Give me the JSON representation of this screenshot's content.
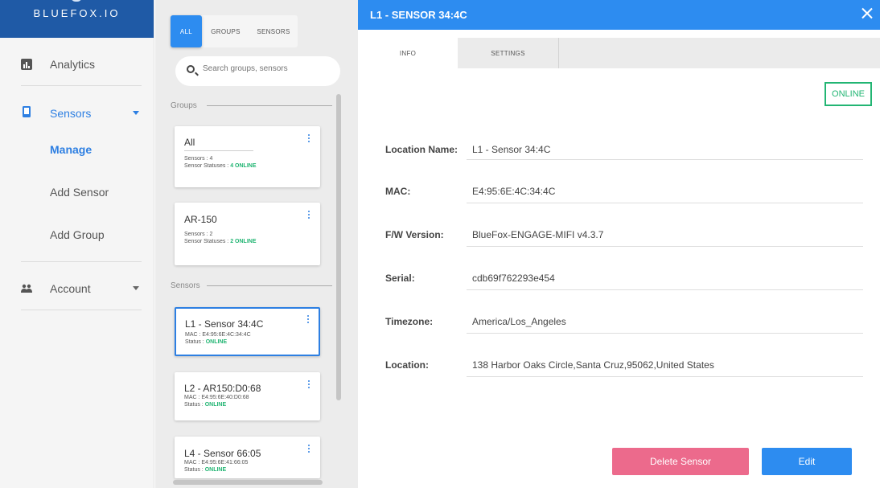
{
  "app": {
    "brand": "BLUEFOX.IO"
  },
  "nav": {
    "analytics": {
      "label": "Analytics",
      "icon": "bar-chart-icon"
    },
    "sensors": {
      "label": "Sensors",
      "icon": "phone-device-icon"
    },
    "sensors_sub": [
      "Manage",
      "Add Sensor",
      "Add Group"
    ],
    "account": {
      "label": "Account",
      "icon": "people-icon"
    }
  },
  "list": {
    "filters": [
      "ALL",
      "GROUPS",
      "SENSORS"
    ],
    "search_placeholder": "Search groups, sensors",
    "groups_heading": "Groups",
    "sensors_heading": "Sensors",
    "groups": [
      {
        "title": "All",
        "sensors": "Sensors : 4",
        "status_prefix": "Sensor Statuses : ",
        "status": "4 ONLINE"
      },
      {
        "title": "AR-150",
        "sensors": "Sensors : 2",
        "status_prefix": "Sensor Statuses : ",
        "status": "2 ONLINE"
      }
    ],
    "sensors": [
      {
        "title": "L1 - Sensor 34:4C",
        "mac": "MAC : E4:95:6E:4C:34:4C",
        "status_prefix": "Status : ",
        "status": "ONLINE"
      },
      {
        "title": "L2 - AR150:D0:68",
        "mac": "MAC : E4:95:6E:40:D0:68",
        "status_prefix": "Status : ",
        "status": "ONLINE"
      },
      {
        "title": "L4 - Sensor 66:05",
        "mac": "MAC : E4:95:6E:41:66:05",
        "status_prefix": "Status : ",
        "status": "ONLINE"
      }
    ]
  },
  "panel": {
    "title": "L1 - SENSOR 34:4C",
    "tabs": [
      "INFO",
      "SETTINGS"
    ],
    "status_badge": "ONLINE",
    "fields": [
      {
        "label": "Location Name:",
        "value": "L1 - Sensor 34:4C"
      },
      {
        "label": "MAC:",
        "value": "E4:95:6E:4C:34:4C"
      },
      {
        "label": "F/W Version:",
        "value": "BlueFox-ENGAGE-MIFI v4.3.7"
      },
      {
        "label": "Serial:",
        "value": "cdb69f762293e454"
      },
      {
        "label": "Timezone:",
        "value": "America/Los_Angeles"
      },
      {
        "label": "Location:",
        "value": "138 Harbor Oaks Circle,Santa Cruz,95062,United States"
      }
    ],
    "delete_label": "Delete Sensor",
    "edit_label": "Edit"
  },
  "colors": {
    "primary": "#2d8cf0",
    "brand": "#1f5aa6",
    "online": "#22b573",
    "danger": "#ec6a8c"
  }
}
